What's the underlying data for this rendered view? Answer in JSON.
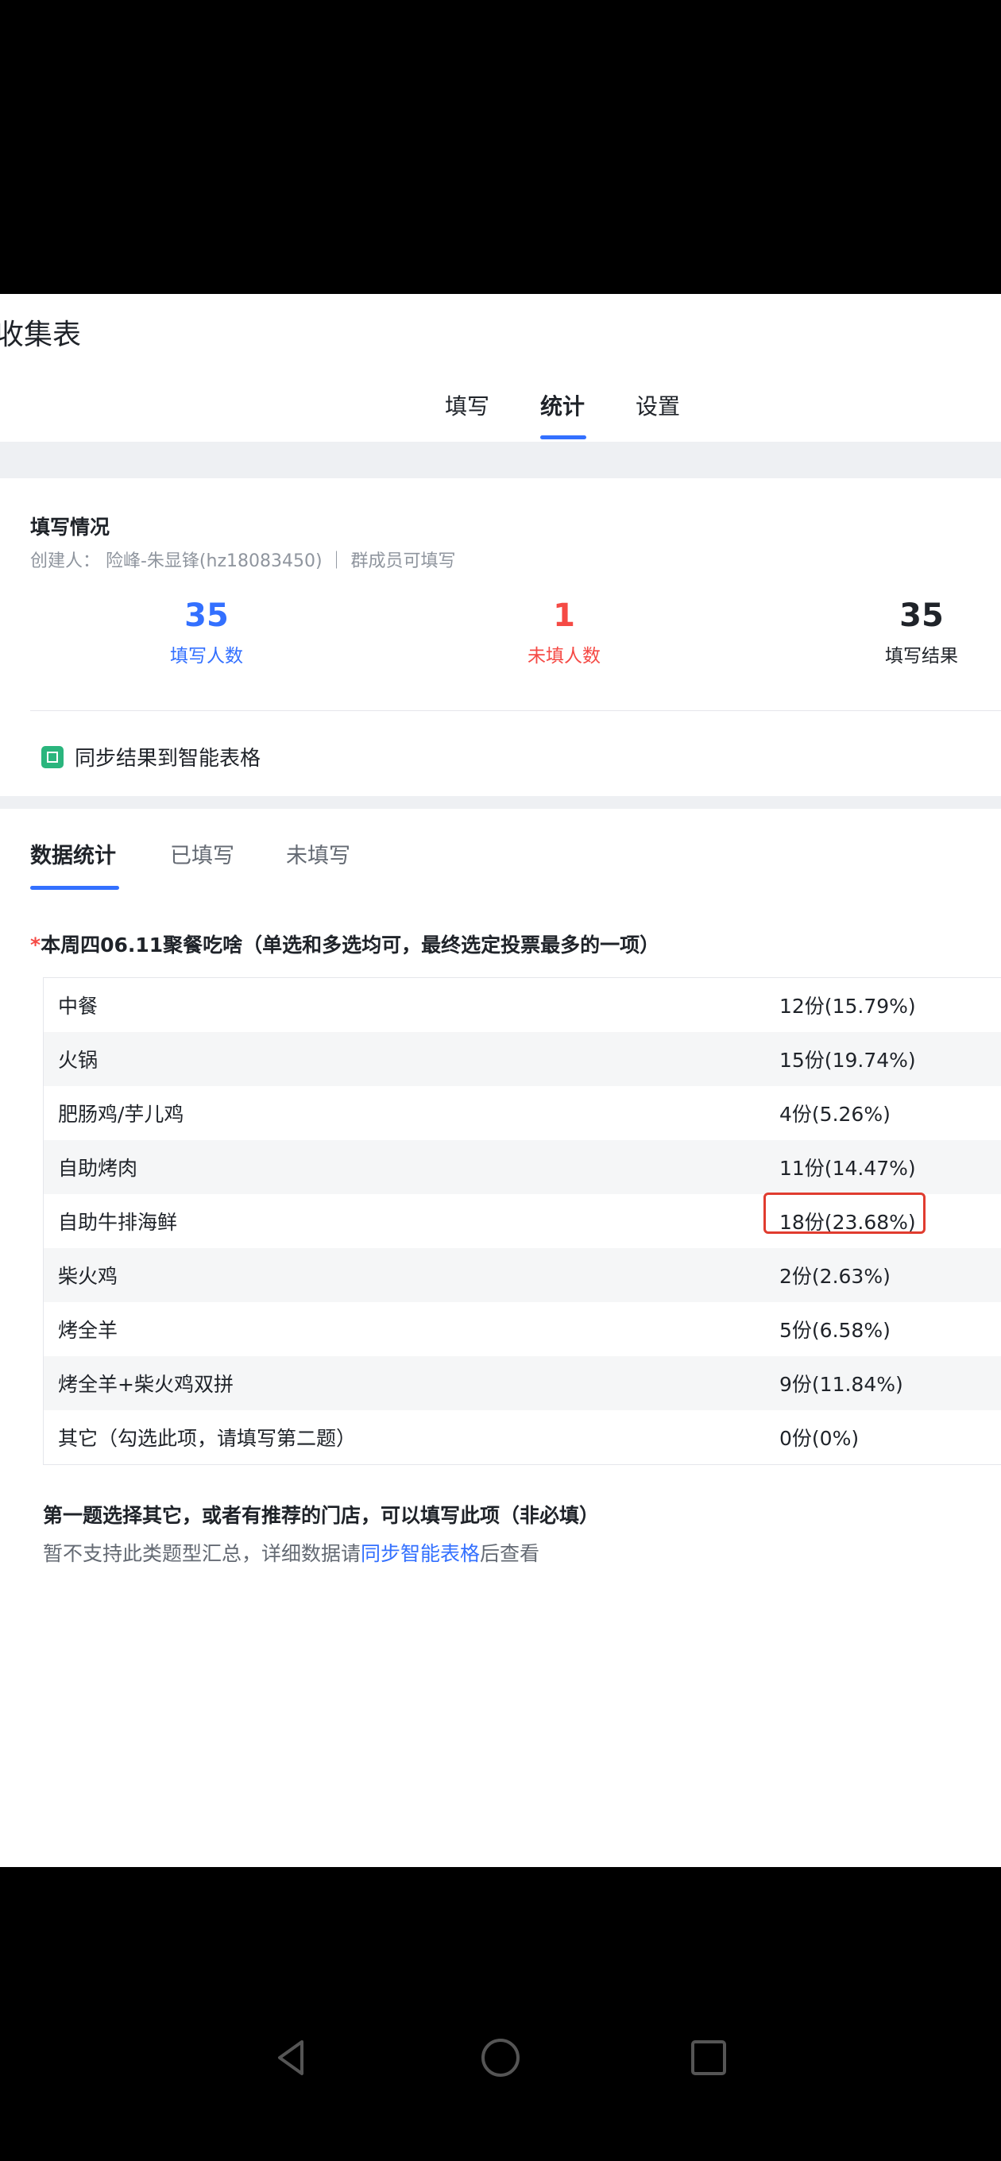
{
  "header": {
    "title": "收集表"
  },
  "top_tabs": [
    {
      "label": "填写"
    },
    {
      "label": "统计"
    },
    {
      "label": "设置"
    }
  ],
  "summary": {
    "title": "填写情况",
    "creator": "创建人：  险峰-朱显锋(hz18083450) ｜ 群成员可填写",
    "stats": [
      {
        "value": "35",
        "label": "填写人数",
        "color": "#3370ff"
      },
      {
        "value": "1",
        "label": "未填人数",
        "color": "#f54a45"
      },
      {
        "value": "35",
        "label": "填写结果",
        "color": "#1f2329"
      }
    ],
    "sync_label": "同步结果到智能表格"
  },
  "sub_tabs": [
    {
      "label": "数据统计"
    },
    {
      "label": "已填写"
    },
    {
      "label": "未填写"
    }
  ],
  "question": {
    "star": "*",
    "text": "本周四06.11聚餐吃啥（单选和多选均可，最终选定投票最多的一项）"
  },
  "options": [
    {
      "name": "中餐",
      "result": "12份(15.79%)"
    },
    {
      "name": "火锅",
      "result": "15份(19.74%)"
    },
    {
      "name": "肥肠鸡/芋儿鸡",
      "result": "4份(5.26%)"
    },
    {
      "name": "自助烤肉",
      "result": "11份(14.47%)"
    },
    {
      "name": "自助牛排海鲜",
      "result": "18份(23.68%)"
    },
    {
      "name": "柴火鸡",
      "result": "2份(2.63%)"
    },
    {
      "name": "烤全羊",
      "result": "5份(6.58%)"
    },
    {
      "name": "烤全羊+柴火鸡双拼",
      "result": "9份(11.84%)"
    },
    {
      "name": "其它（勾选此项，请填写第二题）",
      "result": "0份(0%)"
    }
  ],
  "notes": {
    "q2": "第一题选择其它，或者有推荐的门店，可以填写此项（非必填）",
    "unsupported_prefix": "暂不支持此类题型汇总，详细数据请",
    "unsupported_link": "同步智能表格",
    "unsupported_suffix": "后查看"
  },
  "nav_icons": [
    "back-icon",
    "home-icon",
    "recents-icon"
  ]
}
